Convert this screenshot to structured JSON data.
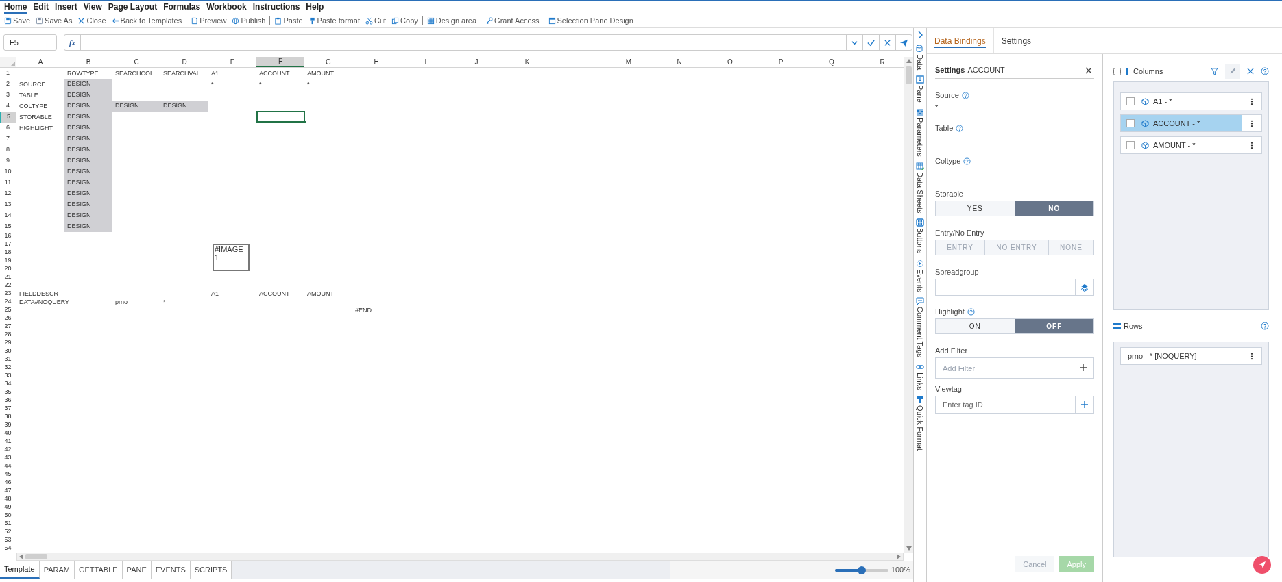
{
  "menu": [
    {
      "label": "Home",
      "selected": true
    },
    {
      "label": "Edit",
      "selected": false
    },
    {
      "label": "Insert",
      "selected": false
    },
    {
      "label": "View",
      "selected": false
    },
    {
      "label": "Page Layout",
      "selected": false
    },
    {
      "label": "Formulas",
      "selected": false
    },
    {
      "label": "Workbook",
      "selected": false
    },
    {
      "label": "Instructions",
      "selected": false
    },
    {
      "label": "Help",
      "selected": false
    }
  ],
  "toolbar": [
    {
      "items": [
        {
          "label": "Save"
        },
        {
          "label": "Save As"
        },
        {
          "label": "Close"
        },
        {
          "label": "Back to Templates"
        }
      ]
    },
    {
      "items": [
        {
          "label": "Preview"
        },
        {
          "label": "Publish"
        }
      ]
    },
    {
      "items": [
        {
          "label": "Paste"
        },
        {
          "label": "Paste format"
        },
        {
          "label": "Cut"
        },
        {
          "label": "Copy"
        }
      ]
    },
    {
      "items": [
        {
          "label": "Design area"
        }
      ]
    },
    {
      "items": [
        {
          "label": "Grant Access"
        }
      ]
    },
    {
      "items": [
        {
          "label": "Selection Pane Design"
        }
      ]
    }
  ],
  "formula_bar": {
    "cell_ref": "F5",
    "fx_label": "fx"
  },
  "sheet": {
    "columns": [
      {
        "label": "A",
        "selected": false
      },
      {
        "label": "B",
        "selected": false
      },
      {
        "label": "C",
        "selected": false
      },
      {
        "label": "D",
        "selected": false
      },
      {
        "label": "E",
        "selected": false
      },
      {
        "label": "F",
        "selected": true
      },
      {
        "label": "G",
        "selected": false
      },
      {
        "label": "H",
        "selected": false
      },
      {
        "label": "I",
        "selected": false
      },
      {
        "label": "J",
        "selected": false
      },
      {
        "label": "K",
        "selected": false
      },
      {
        "label": "L",
        "selected": false
      },
      {
        "label": "M",
        "selected": false
      },
      {
        "label": "N",
        "selected": false
      },
      {
        "label": "O",
        "selected": false
      },
      {
        "label": "P",
        "selected": false
      },
      {
        "label": "Q",
        "selected": false
      },
      {
        "label": "R",
        "selected": false
      }
    ],
    "rows": [
      {
        "label": "1",
        "selected": false,
        "cells": [
          {
            "shaded": false
          },
          {
            "text": "ROWTYPE",
            "shaded": false
          },
          {
            "text": "SEARCHCOL",
            "shaded": false
          },
          {
            "text": "SEARCHVAL",
            "shaded": false
          },
          {
            "text": "A1",
            "shaded": false
          },
          {
            "text": "ACCOUNT",
            "shaded": false
          },
          {
            "text": "AMOUNT",
            "shaded": false
          }
        ]
      },
      {
        "label": "2",
        "selected": false,
        "cells": [
          {
            "text": "SOURCE",
            "shaded": false
          },
          {
            "text": "DESIGN",
            "shaded": true
          },
          {
            "shaded": false
          },
          {
            "shaded": false
          },
          {
            "text": "*",
            "shaded": false
          },
          {
            "text": "*",
            "shaded": false
          },
          {
            "text": "*",
            "shaded": false
          }
        ]
      },
      {
        "label": "3",
        "selected": false,
        "cells": [
          {
            "text": "TABLE",
            "shaded": false
          },
          {
            "text": "DESIGN",
            "shaded": true
          }
        ]
      },
      {
        "label": "4",
        "selected": false,
        "cells": [
          {
            "text": "COLTYPE",
            "shaded": false
          },
          {
            "text": "DESIGN",
            "shaded": true
          },
          {
            "text": "DESIGN",
            "shaded": true
          },
          {
            "text": "DESIGN",
            "shaded": true
          }
        ]
      },
      {
        "label": "5",
        "selected": true,
        "cells": [
          {
            "text": "STORABLE",
            "shaded": false
          },
          {
            "text": "DESIGN",
            "shaded": true
          }
        ]
      },
      {
        "label": "6",
        "selected": false,
        "cells": [
          {
            "text": "HIGHLIGHT",
            "shaded": false
          },
          {
            "text": "DESIGN",
            "shaded": true
          }
        ]
      },
      {
        "label": "7",
        "selected": false,
        "cells": [
          {
            "shaded": false
          },
          {
            "text": "DESIGN",
            "shaded": true
          }
        ]
      },
      {
        "label": "8",
        "selected": false,
        "cells": [
          {
            "shaded": false
          },
          {
            "text": "DESIGN",
            "shaded": true
          }
        ]
      },
      {
        "label": "9",
        "selected": false,
        "cells": [
          {
            "shaded": false
          },
          {
            "text": "DESIGN",
            "shaded": true
          }
        ]
      },
      {
        "label": "10",
        "selected": false,
        "cells": [
          {
            "shaded": false
          },
          {
            "text": "DESIGN",
            "shaded": true
          }
        ]
      },
      {
        "label": "11",
        "selected": false,
        "cells": [
          {
            "shaded": false
          },
          {
            "text": "DESIGN",
            "shaded": true
          }
        ]
      },
      {
        "label": "12",
        "selected": false,
        "cells": [
          {
            "shaded": false
          },
          {
            "text": "DESIGN",
            "shaded": true
          }
        ]
      },
      {
        "label": "13",
        "selected": false,
        "cells": [
          {
            "shaded": false
          },
          {
            "text": "DESIGN",
            "shaded": true
          }
        ]
      },
      {
        "label": "14",
        "selected": false,
        "cells": [
          {
            "shaded": false
          },
          {
            "text": "DESIGN",
            "shaded": true
          }
        ]
      },
      {
        "label": "15",
        "selected": false,
        "cells": [
          {
            "shaded": false
          },
          {
            "text": "DESIGN",
            "shaded": true
          }
        ]
      },
      {
        "label": "16",
        "selected": false
      },
      {
        "label": "17",
        "selected": false
      },
      {
        "label": "18",
        "selected": false
      },
      {
        "label": "19",
        "selected": false
      },
      {
        "label": "20",
        "selected": false
      },
      {
        "label": "21",
        "selected": false
      },
      {
        "label": "22",
        "selected": false
      },
      {
        "label": "23",
        "selected": false,
        "cells": [
          {
            "text": "FIELDDESCR",
            "shaded": false
          },
          {
            "shaded": false
          },
          {
            "shaded": false
          },
          {
            "shaded": false
          },
          {
            "text": "A1",
            "shaded": false
          },
          {
            "text": "ACCOUNT",
            "shaded": false
          },
          {
            "text": "AMOUNT",
            "shaded": false
          }
        ]
      },
      {
        "label": "24",
        "selected": false,
        "cells": [
          {
            "text": "DATA#NOQUERY",
            "shaded": false
          },
          {
            "shaded": false
          },
          {
            "text": "prno",
            "shaded": false
          },
          {
            "text": "*",
            "shaded": false
          }
        ]
      },
      {
        "label": "25",
        "selected": false,
        "cells": [
          {
            "shaded": false
          },
          {
            "shaded": false
          },
          {
            "shaded": false
          },
          {
            "shaded": false
          },
          {
            "shaded": false
          },
          {
            "shaded": false
          },
          {
            "shaded": false
          },
          {
            "text": "#END",
            "shaded": false
          }
        ]
      },
      {
        "label": "26",
        "selected": false
      },
      {
        "label": "27",
        "selected": false
      },
      {
        "label": "28",
        "selected": false
      },
      {
        "label": "29",
        "selected": false
      },
      {
        "label": "30",
        "selected": false
      },
      {
        "label": "31",
        "selected": false
      },
      {
        "label": "32",
        "selected": false
      },
      {
        "label": "33",
        "selected": false
      },
      {
        "label": "34",
        "selected": false
      },
      {
        "label": "35",
        "selected": false
      },
      {
        "label": "36",
        "selected": false
      },
      {
        "label": "37",
        "selected": false
      },
      {
        "label": "38",
        "selected": false
      },
      {
        "label": "39",
        "selected": false
      },
      {
        "label": "40",
        "selected": false
      },
      {
        "label": "41",
        "selected": false
      },
      {
        "label": "42",
        "selected": false
      },
      {
        "label": "43",
        "selected": false
      },
      {
        "label": "44",
        "selected": false
      },
      {
        "label": "45",
        "selected": false
      },
      {
        "label": "46",
        "selected": false
      },
      {
        "label": "47",
        "selected": false
      },
      {
        "label": "48",
        "selected": false
      },
      {
        "label": "49",
        "selected": false
      },
      {
        "label": "50",
        "selected": false
      },
      {
        "label": "51",
        "selected": false
      },
      {
        "label": "52",
        "selected": false
      },
      {
        "label": "53",
        "selected": false
      },
      {
        "label": "54",
        "selected": false
      }
    ],
    "image_box": {
      "lines": [
        "#IMAGE",
        "1"
      ]
    }
  },
  "sheet_tabs": [
    {
      "label": "Template",
      "selected": true
    },
    {
      "label": "PARAM",
      "selected": false
    },
    {
      "label": "GETTABLE",
      "selected": false
    },
    {
      "label": "PANE",
      "selected": false
    },
    {
      "label": "EVENTS",
      "selected": false
    },
    {
      "label": "SCRIPTS",
      "selected": false
    }
  ],
  "zoom": {
    "level": 0.5,
    "reading": "100%"
  },
  "side_tabs": [
    {
      "label": "Data"
    },
    {
      "label": "Pane"
    },
    {
      "label": "Parameters"
    },
    {
      "label": "Data Sheets"
    },
    {
      "label": "Buttons"
    },
    {
      "label": "Events"
    },
    {
      "label": "Comment Tags"
    },
    {
      "label": "Links"
    },
    {
      "label": "Quick Format"
    }
  ],
  "panel_tabs": [
    {
      "label": "Data Bindings",
      "selected": true
    },
    {
      "label": "Settings",
      "selected": false
    }
  ],
  "settings": {
    "title": "Settings",
    "subject": "ACCOUNT",
    "fields": [
      {
        "kind": "text",
        "label": "Source",
        "help": true,
        "value": "*"
      },
      {
        "kind": "text",
        "label": "Table",
        "help": true
      },
      {
        "kind": "text",
        "label": "Coltype",
        "help": true
      },
      {
        "kind": "toggle",
        "label": "Storable",
        "help": false,
        "disabled": false,
        "options": [
          {
            "label": "YES",
            "selected": false
          },
          {
            "label": "NO",
            "selected": true
          }
        ]
      },
      {
        "kind": "toggle",
        "label": "Entry/No Entry",
        "help": false,
        "disabled": true,
        "options": [
          {
            "label": "ENTRY",
            "selected": false
          },
          {
            "label": "NO ENTRY",
            "selected": false
          },
          {
            "label": "NONE",
            "selected": false
          }
        ]
      },
      {
        "kind": "picker",
        "label": "Spreadgroup",
        "help": false
      },
      {
        "kind": "toggle",
        "label": "Highlight",
        "help": true,
        "disabled": false,
        "options": [
          {
            "label": "ON",
            "selected": false
          },
          {
            "label": "OFF",
            "selected": true
          }
        ]
      },
      {
        "kind": "filter",
        "label": "Add Filter",
        "help": false,
        "placeholder": "Add Filter"
      },
      {
        "kind": "tag",
        "label": "Viewtag",
        "help": false,
        "placeholder": "Enter tag ID"
      }
    ],
    "buttons": [
      {
        "label": "Cancel",
        "kind": "secondary",
        "disabled": true
      },
      {
        "label": "Apply",
        "kind": "primary",
        "disabled": true
      }
    ]
  },
  "columns_panel": {
    "title": "Columns",
    "checked": false,
    "items": [
      {
        "label": "A1 - *",
        "selected": false
      },
      {
        "label": "ACCOUNT - *",
        "selected": true
      },
      {
        "label": "AMOUNT - *",
        "selected": false
      }
    ]
  },
  "rows_panel": {
    "title": "Rows",
    "items": [
      {
        "label": "prno - * [NOQUERY]"
      }
    ]
  }
}
